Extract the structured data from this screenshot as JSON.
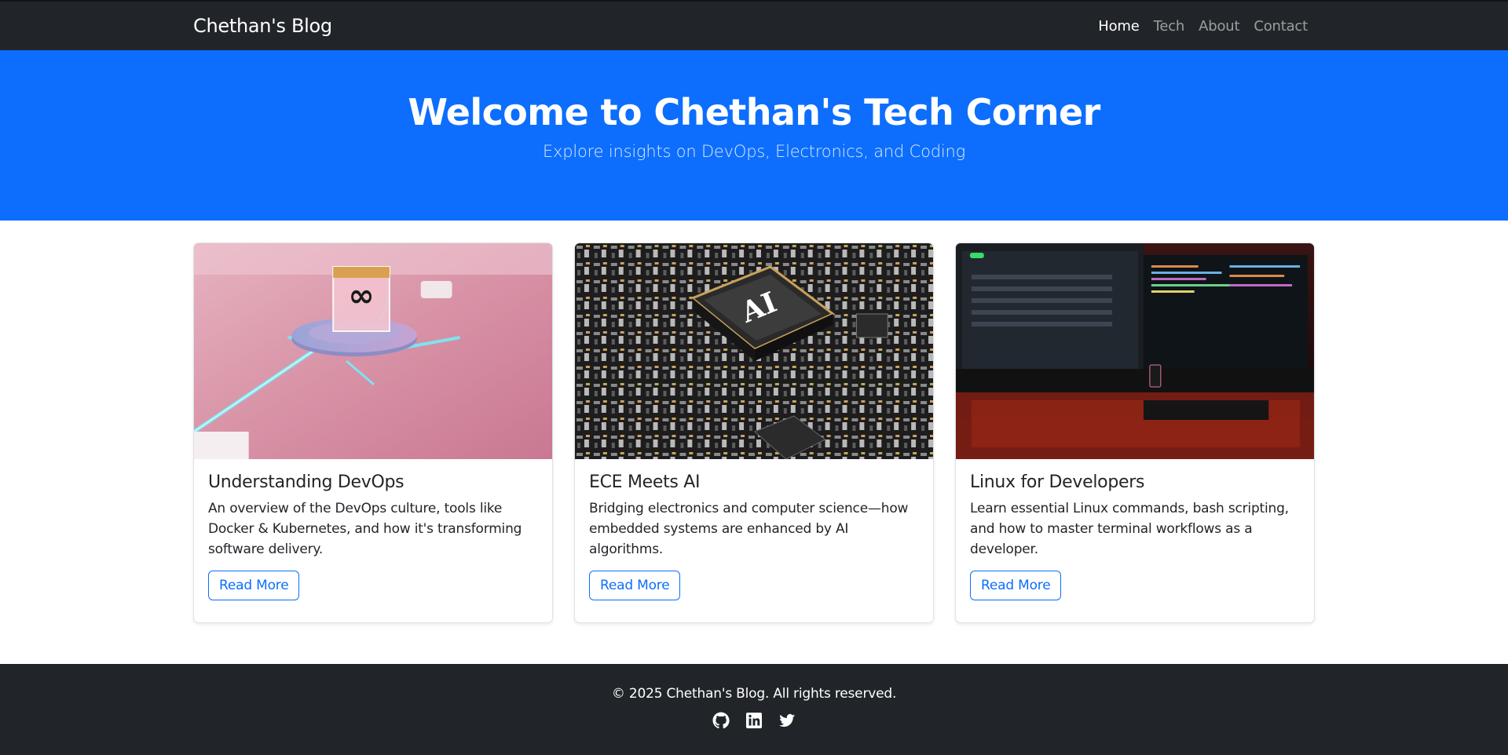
{
  "navbar": {
    "brand": "Chethan's Blog",
    "links": [
      {
        "label": "Home",
        "active": true
      },
      {
        "label": "Tech",
        "active": false
      },
      {
        "label": "About",
        "active": false
      },
      {
        "label": "Contact",
        "active": false
      }
    ]
  },
  "hero": {
    "title": "Welcome to Chethan's Tech Corner",
    "subtitle": "Explore insights on DevOps, Electronics, and Coding"
  },
  "cards": [
    {
      "title": "Understanding DevOps",
      "text": "An overview of the DevOps culture, tools like Docker & Kubernetes, and how it's transforming software delivery.",
      "button": "Read More",
      "image": "devops-infinity-cube-image"
    },
    {
      "title": "ECE Meets AI",
      "text": "Bridging electronics and computer science—how embedded systems are enhanced by AI algorithms.",
      "button": "Read More",
      "image": "ai-chip-circuit-board-image",
      "image_text": "AI"
    },
    {
      "title": "Linux for Developers",
      "text": "Learn essential Linux commands, bash scripting, and how to master terminal workflows as a developer.",
      "button": "Read More",
      "image": "developer-monitors-desk-image"
    }
  ],
  "footer": {
    "copyright": "© 2025 Chethan's Blog. All rights reserved.",
    "social": [
      "github-icon",
      "linkedin-icon",
      "twitter-icon"
    ]
  },
  "colors": {
    "navbar_bg": "#212529",
    "hero_bg": "#0d6efd",
    "primary": "#0d6efd",
    "footer_bg": "#212529"
  }
}
